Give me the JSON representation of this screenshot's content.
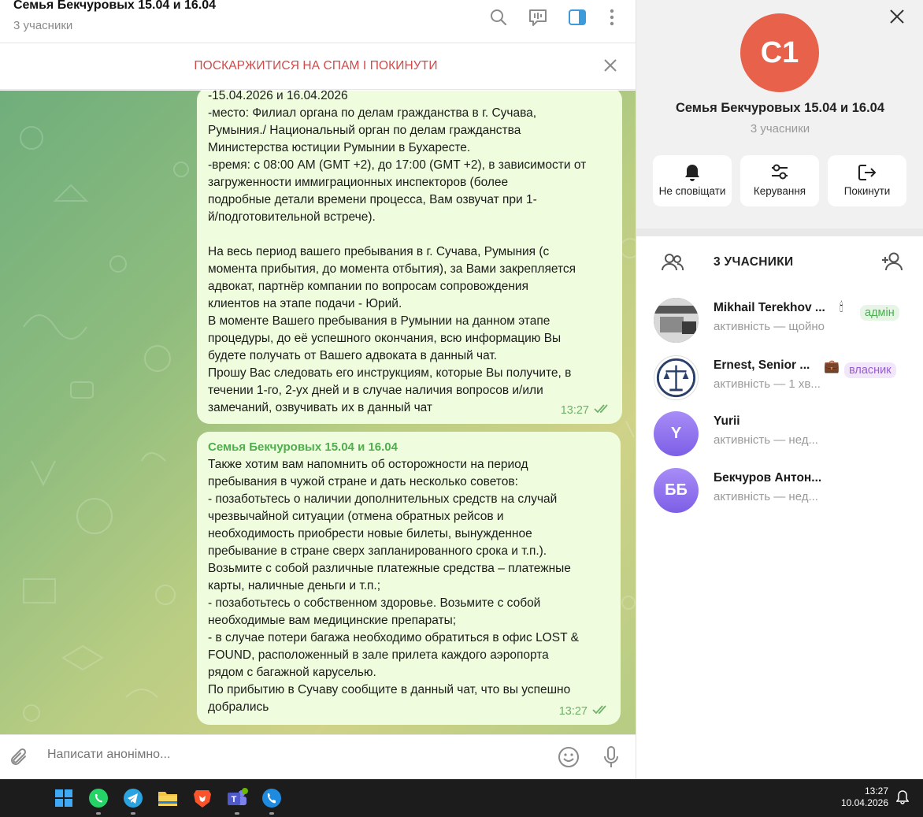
{
  "chat": {
    "title": "Семья Бекчуровых 15.04 и 16.04",
    "subtitle": "3 учасники",
    "spam_bar": "ПОСКАРЖИТИСЯ НА СПАМ І ПОКИНУТИ",
    "composer_placeholder": "Написати анонімно...",
    "messages": [
      {
        "lines": [
          "-15.04.2026 и 16.04.2026",
          "-место: Филиал органа по делам гражданства в г. Сучава,",
          "Румыния./ Национальный орган по делам гражданства",
          "Министерства юстиции Румынии в Бухаресте.",
          "-время: с 08:00 AM (GMT +2), до 17:00 (GMT +2), в зависимости от",
          "загруженности иммиграционных инспекторов (более",
          "подробные детали времени процесса, Вам озвучат при 1-",
          "й/подготовительной встрече).",
          "",
          "На весь период вашего пребывания в г. Сучава, Румыния (с",
          "момента прибытия, до момента отбытия), за Вами закрепляется",
          "адвокат, партнёр компании по вопросам сопровождения",
          "клиентов на этапе подачи - Юрий.",
          "В моменте Вашего пребывания в Румынии на данном этапе",
          "процедуры, до её успешного окончания, всю информацию Вы",
          "будете получать от Вашего адвоката в данный чат.",
          "Прошу Вас следовать его инструкциям, которые Вы получите, в",
          "течении 1-го, 2-ух дней и в случае наличия вопросов и/или",
          "замечаний, озвучивать их в данный чат"
        ],
        "time": "13:27"
      },
      {
        "sender": "Семья Бекчуровых 15.04 и 16.04",
        "lines": [
          "Также хотим вам напомнить об осторожности на период",
          "пребывания в чужой стране и дать несколько советов:",
          "- позаботьтесь о наличии дополнительных средств на случай",
          "чрезвычайной ситуации (отмена обратных рейсов и",
          "необходимость приобрести новые билеты, вынужденное",
          "пребывание в стране сверх запланированного срока и т.п.).",
          "Возьмите с собой различные платежные средства – платежные",
          "карты, наличные деньги и т.п.;",
          "- позаботьтесь о собственном здоровье. Возьмите с собой",
          "необходимые вам медицинские препараты;",
          "- в случае потери багажа необходимо обратиться в офис LOST &",
          "FOUND, расположенный в зале прилета каждого аэропорта",
          "рядом с багажной каруселью.",
          "По прибытию в Сучаву сообщите в данный чат, что вы успешно",
          "добрались"
        ],
        "time": "13:27"
      }
    ]
  },
  "panel": {
    "avatar_initials": "С1",
    "title": "Семья Бекчуровых 15.04 и 16.04",
    "subtitle": "3 учасники",
    "actions": [
      {
        "label": "Не сповіщати",
        "icon": "bell-icon"
      },
      {
        "label": "Керування",
        "icon": "sliders-icon"
      },
      {
        "label": "Покинути",
        "icon": "leave-icon"
      }
    ],
    "members_label": "3 УЧАСНИКИ",
    "members": [
      {
        "name": "Mikhail Terekhov ...",
        "status": "активність — щойно",
        "badge": "адмін",
        "emoji": "🕯"
      },
      {
        "name": "Ernest, Senior ...",
        "status": "активність — 1 хв...",
        "badge": "власник",
        "emoji": "💼"
      },
      {
        "name": "Yurii",
        "status": "активність — нед...",
        "initials": "Y"
      },
      {
        "name": "Бекчуров Антон...",
        "status": "активність — нед...",
        "initials": "ББ"
      }
    ]
  },
  "taskbar": {
    "time": "13:27",
    "date": "10.04.2026"
  },
  "colors": {
    "accent": "#3e9bdb",
    "spam_red": "#d14a4a",
    "bubble": "#effdde",
    "admin_badge": "#4caf50",
    "owner_badge": "#9a5bd6"
  }
}
